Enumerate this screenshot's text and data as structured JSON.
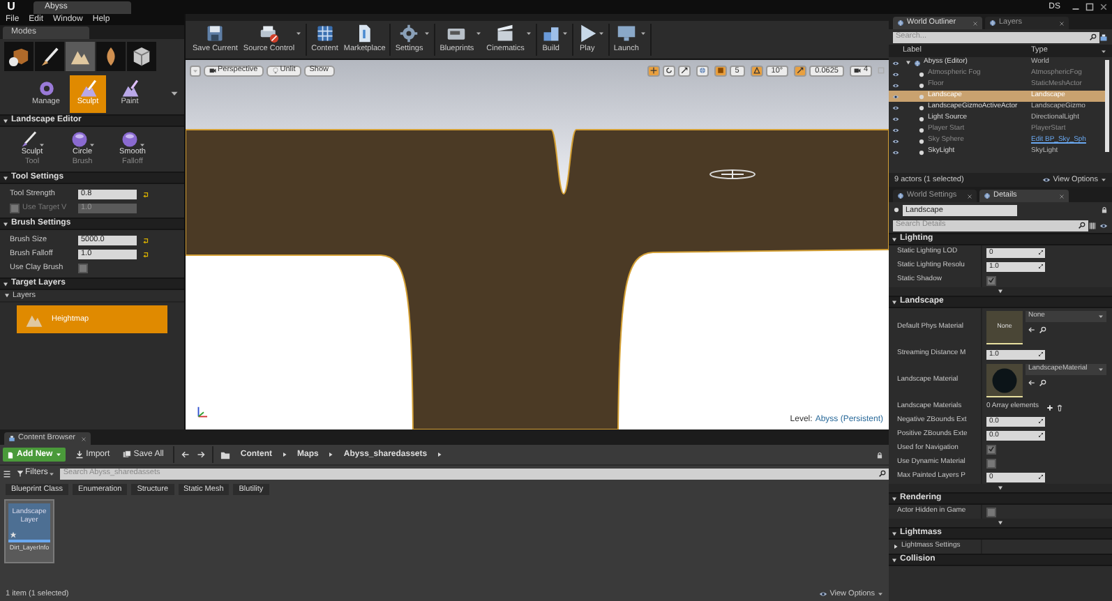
{
  "title_bar": {
    "logo": "U",
    "tab": "Abyss",
    "user": "DS"
  },
  "menu": [
    "File",
    "Edit",
    "Window",
    "Help"
  ],
  "modes": {
    "tab": "Modes",
    "mode_tabs": [
      {
        "kind": "place",
        "selected": false
      },
      {
        "kind": "paint",
        "selected": false
      },
      {
        "kind": "landscape",
        "selected": true
      },
      {
        "kind": "foliage",
        "selected": false
      },
      {
        "kind": "geometry",
        "selected": false
      }
    ],
    "submodes": [
      {
        "label": "Manage",
        "selected": false
      },
      {
        "label": "Sculpt",
        "selected": true
      },
      {
        "label": "Paint",
        "selected": false
      }
    ],
    "sections": [
      {
        "title": "Landscape Editor",
        "kind": "tools",
        "tools": [
          {
            "label": "Sculpt",
            "sublabel": "Tool"
          },
          {
            "label": "Circle",
            "sublabel": "Brush"
          },
          {
            "label": "Smooth",
            "sublabel": "Falloff"
          }
        ]
      },
      {
        "title": "Tool Settings",
        "kind": "props",
        "rows": [
          {
            "kind": "number",
            "label": "Tool Strength",
            "value": "0.8"
          },
          {
            "kind": "check_number",
            "label": "Use Target V",
            "value": "1.0",
            "checked": false
          }
        ]
      },
      {
        "title": "Brush Settings",
        "kind": "props",
        "rows": [
          {
            "kind": "number",
            "label": "Brush Size",
            "value": "5000.0"
          },
          {
            "kind": "number",
            "label": "Brush Falloff",
            "value": "1.0"
          },
          {
            "kind": "check",
            "label": "Use Clay Brush",
            "checked": false
          }
        ]
      },
      {
        "title": "Target Layers",
        "kind": "layers",
        "group": "Layers",
        "layers": [
          {
            "name": "Heightmap",
            "selected": true
          }
        ]
      }
    ]
  },
  "toolbar": [
    [
      {
        "label": "Save Current",
        "kind": "save",
        "dropdown": false
      },
      {
        "label": "Source Control",
        "kind": "source",
        "dropdown": true
      }
    ],
    [
      {
        "label": "Content",
        "kind": "content",
        "dropdown": false
      },
      {
        "label": "Marketplace",
        "kind": "market",
        "dropdown": false
      }
    ],
    [
      {
        "label": "Settings",
        "kind": "settings",
        "dropdown": true
      }
    ],
    [
      {
        "label": "Blueprints",
        "kind": "blueprints",
        "dropdown": true
      },
      {
        "label": "Cinematics",
        "kind": "cinematics",
        "dropdown": true
      }
    ],
    [
      {
        "label": "Build",
        "kind": "build",
        "dropdown": true
      }
    ],
    [
      {
        "label": "Play",
        "kind": "play",
        "dropdown": true
      }
    ],
    [
      {
        "label": "Launch",
        "kind": "launch",
        "dropdown": true
      }
    ]
  ],
  "viewport": {
    "view_buttons": [
      "Perspective",
      "Unlit",
      "Show"
    ],
    "transform_tools": [
      {
        "kind": "move",
        "selected": true
      },
      {
        "kind": "rotate",
        "selected": false
      },
      {
        "kind": "scale",
        "selected": false
      }
    ],
    "snaps": [
      {
        "kind": "grid",
        "value": "5",
        "on": true
      },
      {
        "kind": "rotation",
        "value": "10°",
        "on": true
      },
      {
        "kind": "scale",
        "value": "0.0625",
        "on": true
      }
    ],
    "camera_speed": "4",
    "level_label": "Level:",
    "level_name": "Abyss (Persistent)"
  },
  "content_browser": {
    "tab": "Content Browser",
    "add_new": "Add New",
    "import": "Import",
    "save_all": "Save All",
    "path": [
      "Content",
      "Maps",
      "Abyss_sharedassets"
    ],
    "filters": "Filters",
    "search": {
      "placeholder": "Search Abyss_sharedassets"
    },
    "filter_chips": [
      "Blueprint Class",
      "Enumeration",
      "Structure",
      "Static Mesh",
      "Blutility"
    ],
    "assets": [
      {
        "thumb_label": "Landscape Layer",
        "name": "Dirt_LayerInfo",
        "selected": true
      }
    ],
    "status": "1 item (1 selected)",
    "view_options": "View Options"
  },
  "outliner": {
    "tabs": [
      {
        "label": "World Outliner",
        "selected": true
      },
      {
        "label": "Layers",
        "selected": false
      }
    ],
    "search": {
      "placeholder": "Search..."
    },
    "columns": [
      "Label",
      "Type"
    ],
    "tree": [
      {
        "label": "Abyss (Editor)",
        "type": "World",
        "selected": false,
        "dimmed": false,
        "type_link": false,
        "children": [
          {
            "label": "Atmospheric Fog",
            "type": "AtmosphericFog",
            "selected": false,
            "dimmed": true,
            "type_link": false
          },
          {
            "label": "Floor",
            "type": "StaticMeshActor",
            "selected": false,
            "dimmed": true,
            "type_link": false
          },
          {
            "label": "Landscape",
            "type": "Landscape",
            "selected": true,
            "dimmed": false,
            "type_link": false
          },
          {
            "label": "LandscapeGizmoActiveActor",
            "type": "LandscapeGizmo",
            "selected": false,
            "dimmed": false,
            "type_link": false
          },
          {
            "label": "Light Source",
            "type": "DirectionalLight",
            "selected": false,
            "dimmed": false,
            "type_link": false
          },
          {
            "label": "Player Start",
            "type": "PlayerStart",
            "selected": false,
            "dimmed": true,
            "type_link": false
          },
          {
            "label": "Sky Sphere",
            "type": "Edit BP_Sky_Sph",
            "selected": false,
            "dimmed": true,
            "type_link": true
          },
          {
            "label": "SkyLight",
            "type": "SkyLight",
            "selected": false,
            "dimmed": false,
            "type_link": false
          }
        ]
      }
    ],
    "status": "9 actors (1 selected)",
    "view_options": "View Options"
  },
  "details": {
    "tabs": [
      {
        "label": "World Settings",
        "selected": false
      },
      {
        "label": "Details",
        "selected": true
      }
    ],
    "name": "Landscape",
    "search": {
      "placeholder": "Search Details"
    },
    "sections": [
      {
        "title": "Lighting",
        "advanced": true,
        "rows": [
          {
            "kind": "number",
            "label": "Static Lighting LOD",
            "value": "0"
          },
          {
            "kind": "number",
            "label": "Static Lighting Resolu",
            "value": "1.0"
          },
          {
            "kind": "check",
            "label": "Static Shadow",
            "checked": true
          }
        ]
      },
      {
        "title": "Landscape",
        "advanced": true,
        "rows": [
          {
            "kind": "asset",
            "label": "Default Phys Material",
            "thumb_label": "None",
            "value": "None"
          },
          {
            "kind": "number",
            "label": "Streaming Distance M",
            "value": "1.0"
          },
          {
            "kind": "asset",
            "label": "Landscape Material",
            "value": "LandscapeMaterial"
          },
          {
            "kind": "array",
            "label": "Landscape Materials",
            "value": "0 Array elements"
          },
          {
            "kind": "number",
            "label": "Negative ZBounds Ext",
            "value": "0.0"
          },
          {
            "kind": "number",
            "label": "Positive ZBounds Exte",
            "value": "0.0"
          },
          {
            "kind": "check",
            "label": "Used for Navigation",
            "checked": true
          },
          {
            "kind": "check",
            "label": "Use Dynamic Material",
            "checked": false
          },
          {
            "kind": "number",
            "label": "Max Painted Layers P",
            "value": "0"
          }
        ]
      },
      {
        "title": "Rendering",
        "advanced": true,
        "rows": [
          {
            "kind": "check",
            "label": "Actor Hidden in Game",
            "checked": false
          }
        ]
      },
      {
        "title": "Lightmass",
        "advanced": false,
        "rows": [
          {
            "kind": "group",
            "label": "Lightmass Settings"
          }
        ]
      },
      {
        "title": "Collision",
        "advanced": false
      }
    ]
  }
}
